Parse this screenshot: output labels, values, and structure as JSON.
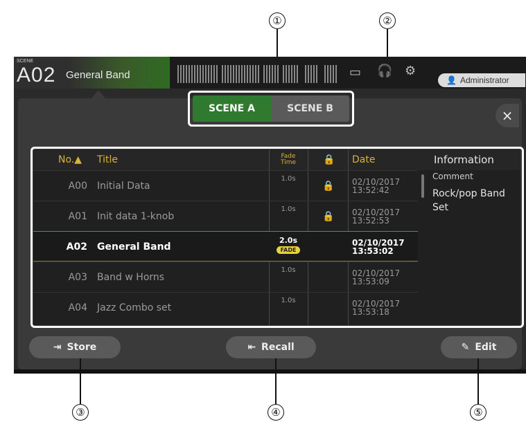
{
  "callouts": [
    "①",
    "②",
    "③",
    "④",
    "⑤"
  ],
  "topbar": {
    "scene_label": "SCENE",
    "scene_id": "A02",
    "scene_name": "General Band",
    "user": "Administrator"
  },
  "tabs": [
    "SCENE A",
    "SCENE B"
  ],
  "close_label": "×",
  "table": {
    "headers": {
      "no": "No.▲",
      "title": "Title",
      "fade_time_1": "Fade",
      "fade_time_2": "Time",
      "date": "Date",
      "info": "Information"
    },
    "rows": [
      {
        "no": "A00",
        "title": "Initial Data",
        "fade": "1.0s",
        "locked": true,
        "date1": "02/10/2017",
        "date2": "13:52:42"
      },
      {
        "no": "A01",
        "title": "Init data 1-knob",
        "fade": "1.0s",
        "locked": true,
        "date1": "02/10/2017",
        "date2": "13:52:53"
      },
      {
        "no": "A02",
        "title": "General Band",
        "fade": "2.0s",
        "fade_badge": "FADE",
        "locked": false,
        "date1": "02/10/2017",
        "date2": "13:53:02",
        "selected": true
      },
      {
        "no": "A03",
        "title": "Band w Horns",
        "fade": "1.0s",
        "locked": false,
        "date1": "02/10/2017",
        "date2": "13:53:09"
      },
      {
        "no": "A04",
        "title": "Jazz Combo set",
        "fade": "1.0s",
        "locked": false,
        "date1": "02/10/2017",
        "date2": "13:53:18"
      }
    ],
    "info": {
      "label": "Comment",
      "text": "Rock/pop Band Set"
    }
  },
  "buttons": {
    "store": "Store",
    "recall": "Recall",
    "edit": "Edit"
  },
  "colors": {
    "accent_green": "#2f7a2f",
    "header_gold": "#d7b33a",
    "fade_badge": "#e8d23a"
  }
}
